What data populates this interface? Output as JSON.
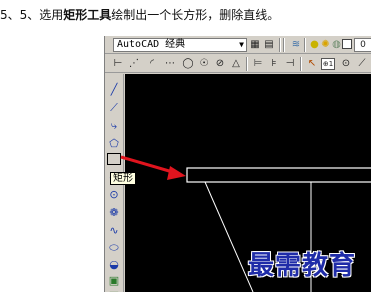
{
  "instruction": {
    "prefix": "5、5、选用",
    "tool_name": "矩形工具",
    "suffix": "绘制出一个长方形，删除直线。"
  },
  "toolbar": {
    "workspace_value": "AutoCAD 经典",
    "row1_icons": [
      "workspace-settings-icon",
      "layer-manager-icon",
      "lightbulb-icon",
      "sun-icon",
      "layer-color-icon"
    ],
    "row2_icons": [
      "linear-dimension-icon",
      "aligned-dimension-icon",
      "arc-length-icon",
      "ordinate-icon",
      "radius-icon",
      "jogged-icon",
      "diameter-icon",
      "angular-icon",
      "quick-dimension-icon",
      "baseline-icon",
      "continue-icon",
      "leader-icon",
      "tolerance-icon",
      "center-mark-icon"
    ]
  },
  "draw_toolbar": {
    "tools": [
      "line-icon",
      "construction-line-icon",
      "polyline-icon",
      "polygon-icon",
      "rectangle-icon",
      "arc-icon",
      "circle-icon",
      "revision-cloud-icon",
      "spline-icon",
      "ellipse-icon",
      "ellipse-arc-icon",
      "insert-block-icon",
      "make-block-icon"
    ]
  },
  "tooltip": {
    "text": "矩形"
  },
  "watermark": {
    "text": "最需教育"
  },
  "colors": {
    "canvas": "#000000",
    "accent_arrow": "#e0141e",
    "watermark": "#1f2ca8"
  }
}
